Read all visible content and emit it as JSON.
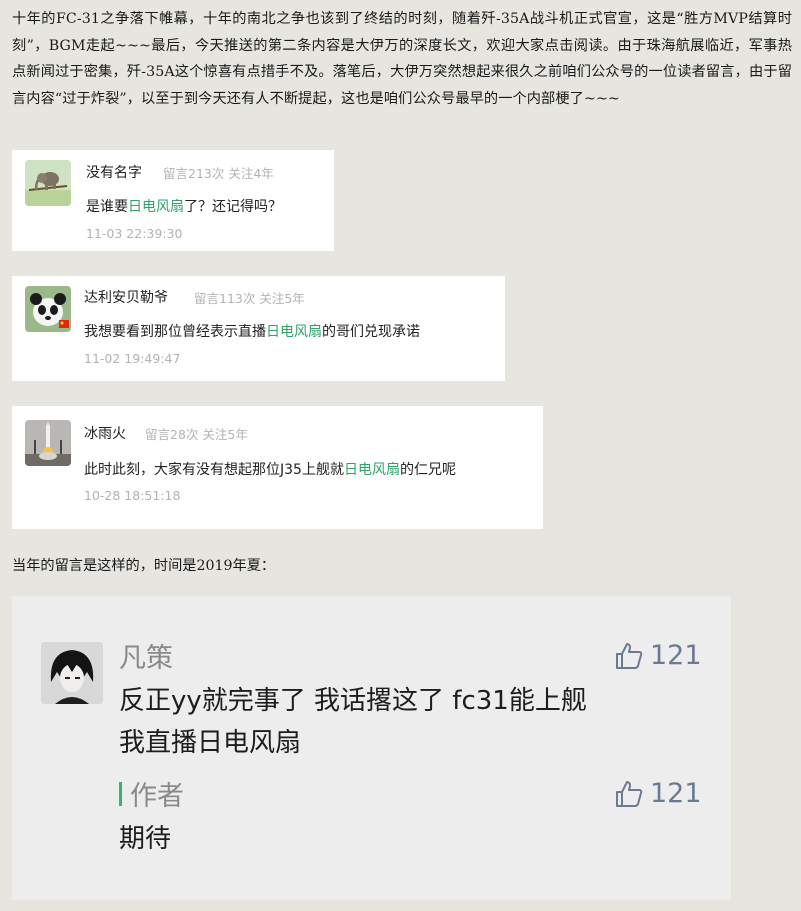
{
  "intro": {
    "text": "十年的FC-31之争落下帷幕，十年的南北之争也该到了终结的时刻，随着歼-35A战斗机正式官宣，这是“胜方MVP结算时刻”，BGM走起~~~最后，今天推送的第二条内容是大伊万的深度长文，欢迎大家点击阅读。由于珠海航展临近，军事热点新闻过于密集，歼-35A这个惊喜有点措手不及。落笔后，大伊万突然想起来很久之前咱们公众号的一位读者留言，由于留言内容“过于炸裂”，以至于到今天还有人不断提起，这也是咱们公众号最早的一个内部梗了~~~"
  },
  "comments": [
    {
      "name": "没有名字",
      "stats": "留言213次 关注4年",
      "text_before": "是谁要",
      "highlight": "日电风扇",
      "text_after": "了？还记得吗？",
      "time": "11-03 22:39:30",
      "avatar_icon": "elephant-on-branch-avatar"
    },
    {
      "name": "达利安贝勒爷",
      "stats": "留言113次 关注5年",
      "text_before": "我想要看到那位曾经表示直播",
      "highlight": "日电风扇",
      "text_after": "的哥们兑现承诺",
      "time": "11-02 19:49:47",
      "avatar_icon": "panda-avatar"
    },
    {
      "name": "冰雨火",
      "stats": "留言28次 关注5年",
      "text_before": "此时此刻，大家有没有想起那位J35上舰就",
      "highlight": "日电风扇",
      "text_after": "的仁兄呢",
      "time": "10-28 18:51:18",
      "avatar_icon": "rocket-launch-avatar"
    }
  ],
  "middle_text": "当年的留言是这样的，时间是2019年夏：",
  "old_comment": {
    "name": "凡策",
    "likes": "121",
    "line1": "反正yy就完事了 我话撂这了 fc31能上舰",
    "line2": "我直播日电风扇",
    "author_label": "作者",
    "author_likes": "121",
    "author_reply": "期待"
  },
  "colors": {
    "background": "#e6e5df",
    "highlight_green": "#2fa367",
    "author_bar": "#3bb26a",
    "thumb": "#6b7a93"
  }
}
